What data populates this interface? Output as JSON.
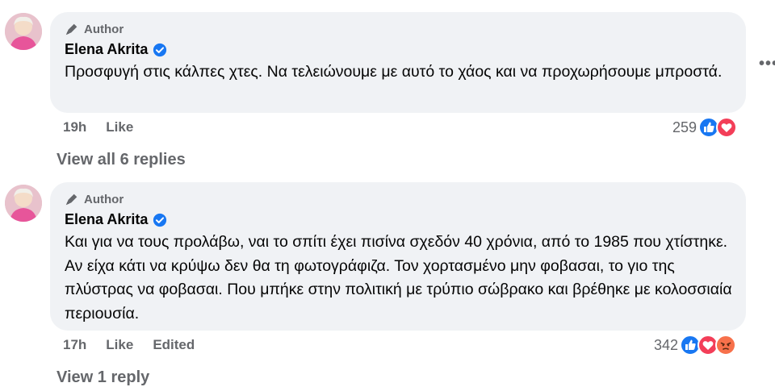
{
  "comments": [
    {
      "badge": "Author",
      "name": "Elena Akrita",
      "text": "Προσφυγή στις κάλπες χτες. Να τελειώνουμε με αυτό το χάος και να προχωρήσουμε μπροστά.",
      "time": "19h",
      "like_label": "Like",
      "reaction_count": "259",
      "reactions": [
        "like-icon",
        "love-icon"
      ],
      "view_replies": "View all 6 replies"
    },
    {
      "badge": "Author",
      "name": "Elena Akrita",
      "text": "Και για να τους προλάβω, ναι το σπίτι έχει πισίνα σχεδόν 40 χρόνια, από το 1985 που χτίστηκε. Αν είχα κάτι να κρύψω δεν θα τη φωτογράφιζα. Τον χορτασμένο μην φοβασαι, το γιο της πλύστρας να φοβασαι. Που μπήκε στην πολιτική με τρύπιο σώβρακο και βρέθηκε με κολοσσιαία περιουσία.",
      "time": "17h",
      "like_label": "Like",
      "edited_label": "Edited",
      "reaction_count": "342",
      "reactions": [
        "like-icon",
        "love-icon",
        "angry-icon"
      ],
      "view_replies": "View 1 reply"
    }
  ],
  "more_icon": "more-options-icon",
  "colors": {
    "bubble": "#f0f2f5",
    "secondary_text": "#65676b",
    "verified": "#1877f2",
    "like": "#1877f2",
    "love": "#f33e58",
    "angry": "#f7714b"
  }
}
